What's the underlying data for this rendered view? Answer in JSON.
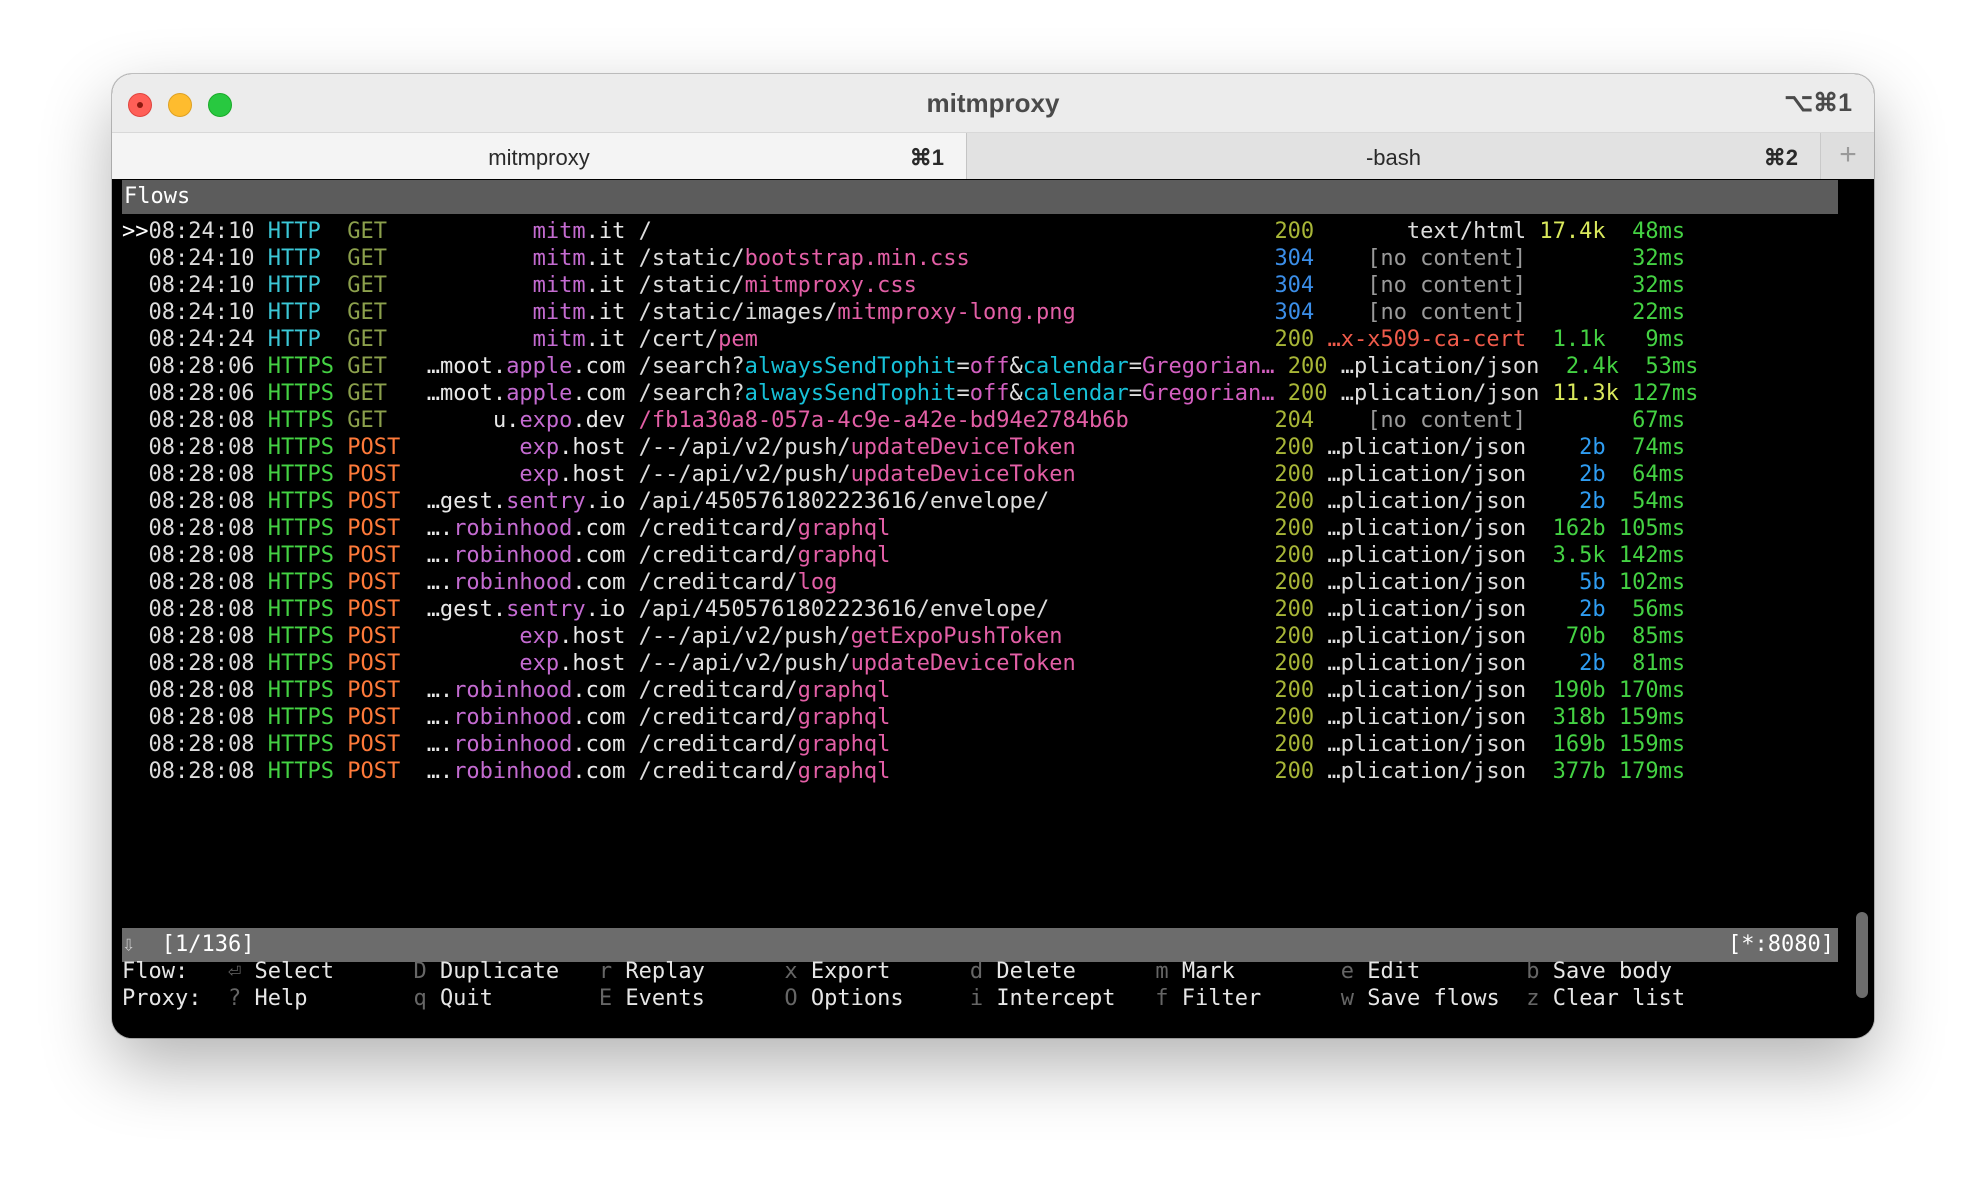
{
  "window": {
    "title": "mitmproxy",
    "shortcut": "⌥⌘1"
  },
  "tabs": [
    {
      "label": "mitmproxy",
      "shortcut": "⌘1"
    },
    {
      "label": "-bash",
      "shortcut": "⌘2"
    }
  ],
  "flows_header": "Flows",
  "flows": [
    {
      "sel": ">>",
      "time": "08:24:10",
      "proto": "HTTP",
      "method": "GET",
      "host_prefix": "",
      "host_hl": "mitm",
      "host_suffix": ".it",
      "path_segments": [
        {
          "text": "/",
          "style": "plain"
        }
      ],
      "status": "200",
      "ctype": "text/html",
      "size": "17.4k",
      "duration": "48ms"
    },
    {
      "sel": "",
      "time": "08:24:10",
      "proto": "HTTP",
      "method": "GET",
      "host_prefix": "",
      "host_hl": "mitm",
      "host_suffix": ".it",
      "path_segments": [
        {
          "text": "/static/",
          "style": "plain"
        },
        {
          "text": "bootstrap.min.css",
          "style": "hl"
        }
      ],
      "status": "304",
      "ctype": "[no content]",
      "size": "",
      "duration": "32ms"
    },
    {
      "sel": "",
      "time": "08:24:10",
      "proto": "HTTP",
      "method": "GET",
      "host_prefix": "",
      "host_hl": "mitm",
      "host_suffix": ".it",
      "path_segments": [
        {
          "text": "/static/",
          "style": "plain"
        },
        {
          "text": "mitmproxy.css",
          "style": "hl"
        }
      ],
      "status": "304",
      "ctype": "[no content]",
      "size": "",
      "duration": "32ms"
    },
    {
      "sel": "",
      "time": "08:24:10",
      "proto": "HTTP",
      "method": "GET",
      "host_prefix": "",
      "host_hl": "mitm",
      "host_suffix": ".it",
      "path_segments": [
        {
          "text": "/static/images/",
          "style": "plain"
        },
        {
          "text": "mitmproxy-long.png",
          "style": "hl"
        }
      ],
      "status": "304",
      "ctype": "[no content]",
      "size": "",
      "duration": "22ms"
    },
    {
      "sel": "",
      "time": "08:24:24",
      "proto": "HTTP",
      "method": "GET",
      "host_prefix": "",
      "host_hl": "mitm",
      "host_suffix": ".it",
      "path_segments": [
        {
          "text": "/cert/",
          "style": "plain"
        },
        {
          "text": "pem",
          "style": "hl"
        }
      ],
      "status": "200",
      "ctype": "…x-x509-ca-cert",
      "size": "1.1k",
      "duration": "9ms"
    },
    {
      "sel": "",
      "time": "08:28:06",
      "proto": "HTTPS",
      "method": "GET",
      "host_prefix": "…moot.",
      "host_hl": "apple",
      "host_suffix": ".com",
      "path_segments": [
        {
          "text": "/search?",
          "style": "plain"
        },
        {
          "text": "alwaysSendTophit",
          "style": "q1"
        },
        {
          "text": "=",
          "style": "plain"
        },
        {
          "text": "off",
          "style": "q2"
        },
        {
          "text": "&",
          "style": "plain"
        },
        {
          "text": "calendar",
          "style": "q1"
        },
        {
          "text": "=",
          "style": "plain"
        },
        {
          "text": "Gregorian…",
          "style": "q2"
        }
      ],
      "status": "200",
      "ctype": "…plication/json",
      "size": "2.4k",
      "duration": "53ms"
    },
    {
      "sel": "",
      "time": "08:28:06",
      "proto": "HTTPS",
      "method": "GET",
      "host_prefix": "…moot.",
      "host_hl": "apple",
      "host_suffix": ".com",
      "path_segments": [
        {
          "text": "/search?",
          "style": "plain"
        },
        {
          "text": "alwaysSendTophit",
          "style": "q1"
        },
        {
          "text": "=",
          "style": "plain"
        },
        {
          "text": "off",
          "style": "q2"
        },
        {
          "text": "&",
          "style": "plain"
        },
        {
          "text": "calendar",
          "style": "q1"
        },
        {
          "text": "=",
          "style": "plain"
        },
        {
          "text": "Gregorian…",
          "style": "q2"
        }
      ],
      "status": "200",
      "ctype": "…plication/json",
      "size": "11.3k",
      "duration": "127ms"
    },
    {
      "sel": "",
      "time": "08:28:08",
      "proto": "HTTPS",
      "method": "GET",
      "host_prefix": "u.",
      "host_hl": "expo",
      "host_suffix": ".dev",
      "path_segments": [
        {
          "text": "/fb1a30a8-057a-4c9e-a42e-bd94e2784b6b",
          "style": "hl"
        }
      ],
      "status": "204",
      "ctype": "[no content]",
      "size": "",
      "duration": "67ms"
    },
    {
      "sel": "",
      "time": "08:28:08",
      "proto": "HTTPS",
      "method": "POST",
      "host_prefix": "",
      "host_hl": "exp",
      "host_suffix": ".host",
      "path_segments": [
        {
          "text": "/--/api/v2/push/",
          "style": "plain"
        },
        {
          "text": "updateDeviceToken",
          "style": "hl"
        }
      ],
      "status": "200",
      "ctype": "…plication/json",
      "size": "2b",
      "duration": "74ms"
    },
    {
      "sel": "",
      "time": "08:28:08",
      "proto": "HTTPS",
      "method": "POST",
      "host_prefix": "",
      "host_hl": "exp",
      "host_suffix": ".host",
      "path_segments": [
        {
          "text": "/--/api/v2/push/",
          "style": "plain"
        },
        {
          "text": "updateDeviceToken",
          "style": "hl"
        }
      ],
      "status": "200",
      "ctype": "…plication/json",
      "size": "2b",
      "duration": "64ms"
    },
    {
      "sel": "",
      "time": "08:28:08",
      "proto": "HTTPS",
      "method": "POST",
      "host_prefix": "…gest.",
      "host_hl": "sentry",
      "host_suffix": ".io",
      "path_segments": [
        {
          "text": "/api/4505761802223616/envelope/",
          "style": "plain"
        }
      ],
      "status": "200",
      "ctype": "…plication/json",
      "size": "2b",
      "duration": "54ms"
    },
    {
      "sel": "",
      "time": "08:28:08",
      "proto": "HTTPS",
      "method": "POST",
      "host_prefix": "….",
      "host_hl": "robinhood",
      "host_suffix": ".com",
      "path_segments": [
        {
          "text": "/creditcard/",
          "style": "plain"
        },
        {
          "text": "graphql",
          "style": "hl"
        }
      ],
      "status": "200",
      "ctype": "…plication/json",
      "size": "162b",
      "duration": "105ms"
    },
    {
      "sel": "",
      "time": "08:28:08",
      "proto": "HTTPS",
      "method": "POST",
      "host_prefix": "….",
      "host_hl": "robinhood",
      "host_suffix": ".com",
      "path_segments": [
        {
          "text": "/creditcard/",
          "style": "plain"
        },
        {
          "text": "graphql",
          "style": "hl"
        }
      ],
      "status": "200",
      "ctype": "…plication/json",
      "size": "3.5k",
      "duration": "142ms"
    },
    {
      "sel": "",
      "time": "08:28:08",
      "proto": "HTTPS",
      "method": "POST",
      "host_prefix": "….",
      "host_hl": "robinhood",
      "host_suffix": ".com",
      "path_segments": [
        {
          "text": "/creditcard/",
          "style": "plain"
        },
        {
          "text": "log",
          "style": "hl"
        }
      ],
      "status": "200",
      "ctype": "…plication/json",
      "size": "5b",
      "duration": "102ms"
    },
    {
      "sel": "",
      "time": "08:28:08",
      "proto": "HTTPS",
      "method": "POST",
      "host_prefix": "…gest.",
      "host_hl": "sentry",
      "host_suffix": ".io",
      "path_segments": [
        {
          "text": "/api/4505761802223616/envelope/",
          "style": "plain"
        }
      ],
      "status": "200",
      "ctype": "…plication/json",
      "size": "2b",
      "duration": "56ms"
    },
    {
      "sel": "",
      "time": "08:28:08",
      "proto": "HTTPS",
      "method": "POST",
      "host_prefix": "",
      "host_hl": "exp",
      "host_suffix": ".host",
      "path_segments": [
        {
          "text": "/--/api/v2/push/",
          "style": "plain"
        },
        {
          "text": "getExpoPushToken",
          "style": "hl"
        }
      ],
      "status": "200",
      "ctype": "…plication/json",
      "size": "70b",
      "duration": "85ms"
    },
    {
      "sel": "",
      "time": "08:28:08",
      "proto": "HTTPS",
      "method": "POST",
      "host_prefix": "",
      "host_hl": "exp",
      "host_suffix": ".host",
      "path_segments": [
        {
          "text": "/--/api/v2/push/",
          "style": "plain"
        },
        {
          "text": "updateDeviceToken",
          "style": "hl"
        }
      ],
      "status": "200",
      "ctype": "…plication/json",
      "size": "2b",
      "duration": "81ms"
    },
    {
      "sel": "",
      "time": "08:28:08",
      "proto": "HTTPS",
      "method": "POST",
      "host_prefix": "….",
      "host_hl": "robinhood",
      "host_suffix": ".com",
      "path_segments": [
        {
          "text": "/creditcard/",
          "style": "plain"
        },
        {
          "text": "graphql",
          "style": "hl"
        }
      ],
      "status": "200",
      "ctype": "…plication/json",
      "size": "190b",
      "duration": "170ms"
    },
    {
      "sel": "",
      "time": "08:28:08",
      "proto": "HTTPS",
      "method": "POST",
      "host_prefix": "….",
      "host_hl": "robinhood",
      "host_suffix": ".com",
      "path_segments": [
        {
          "text": "/creditcard/",
          "style": "plain"
        },
        {
          "text": "graphql",
          "style": "hl"
        }
      ],
      "status": "200",
      "ctype": "…plication/json",
      "size": "318b",
      "duration": "159ms"
    },
    {
      "sel": "",
      "time": "08:28:08",
      "proto": "HTTPS",
      "method": "POST",
      "host_prefix": "….",
      "host_hl": "robinhood",
      "host_suffix": ".com",
      "path_segments": [
        {
          "text": "/creditcard/",
          "style": "plain"
        },
        {
          "text": "graphql",
          "style": "hl"
        }
      ],
      "status": "200",
      "ctype": "…plication/json",
      "size": "169b",
      "duration": "159ms"
    },
    {
      "sel": "",
      "time": "08:28:08",
      "proto": "HTTPS",
      "method": "POST",
      "host_prefix": "….",
      "host_hl": "robinhood",
      "host_suffix": ".com",
      "path_segments": [
        {
          "text": "/creditcard/",
          "style": "plain"
        },
        {
          "text": "graphql",
          "style": "hl"
        }
      ],
      "status": "200",
      "ctype": "…plication/json",
      "size": "377b",
      "duration": "179ms"
    }
  ],
  "status_bar": {
    "arrow": "⇩",
    "position": "[1/136]",
    "listen": "[*:8080]"
  },
  "keybindings": {
    "flow_label": "Flow:",
    "proxy_label": "Proxy:",
    "flow": [
      {
        "key": "⏎",
        "label": "Select"
      },
      {
        "key": "D",
        "label": "Duplicate"
      },
      {
        "key": "r",
        "label": "Replay"
      },
      {
        "key": "x",
        "label": "Export"
      },
      {
        "key": "d",
        "label": "Delete"
      },
      {
        "key": "m",
        "label": "Mark"
      },
      {
        "key": "e",
        "label": "Edit"
      },
      {
        "key": "b",
        "label": "Save body"
      }
    ],
    "proxy": [
      {
        "key": "?",
        "label": "Help"
      },
      {
        "key": "q",
        "label": "Quit"
      },
      {
        "key": "E",
        "label": "Events"
      },
      {
        "key": "O",
        "label": "Options"
      },
      {
        "key": "i",
        "label": "Intercept"
      },
      {
        "key": "f",
        "label": "Filter"
      },
      {
        "key": "w",
        "label": "Save flows"
      },
      {
        "key": "z",
        "label": "Clear list"
      }
    ]
  },
  "colors": {
    "http": "#3bc7d6",
    "https": "#44d243",
    "get": "#8ca04c",
    "post": "#ff7a3a",
    "status_ok": "#a8b637",
    "status_not_modified": "#3b8ee8",
    "duration": "#44d243"
  }
}
